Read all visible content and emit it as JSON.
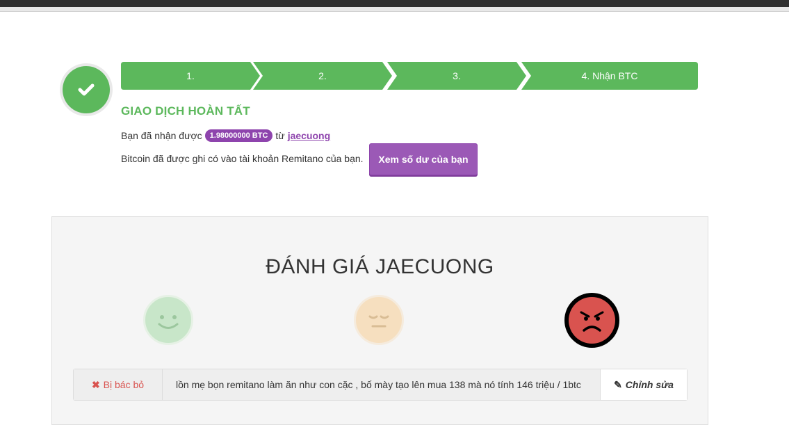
{
  "steps": [
    {
      "label": "1."
    },
    {
      "label": "2."
    },
    {
      "label": "3."
    },
    {
      "label": "4. Nhận BTC"
    }
  ],
  "status": {
    "title": "GIAO DỊCH HOÀN TẤT",
    "received_prefix": "Bạn đã nhận được",
    "amount": "1.98000000 BTC",
    "from_word": "từ",
    "counterparty": "jaecuong",
    "credited_text": "Bitcoin đã được ghi có vào tài khoản Remitano của bạn.",
    "balance_button": "Xem số dư của bạn"
  },
  "rating": {
    "title": "ĐÁNH GIÁ JAECUONG",
    "faces": [
      "happy-face-icon",
      "neutral-face-icon",
      "angry-face-icon"
    ],
    "selected": "angry"
  },
  "review": {
    "rejected_icon": "✖",
    "rejected_label": "Bị bác bỏ",
    "comment": "lồn mẹ bọn remitano làm ăn như con cặc , bố mày tạo lên mua 138 mà nó tính 146 triệu / 1btc",
    "edit_icon": "✎",
    "edit_label": "Chỉnh sửa"
  },
  "colors": {
    "success": "#5cb85c",
    "purple": "#9b59b6",
    "danger": "#d9534f"
  }
}
